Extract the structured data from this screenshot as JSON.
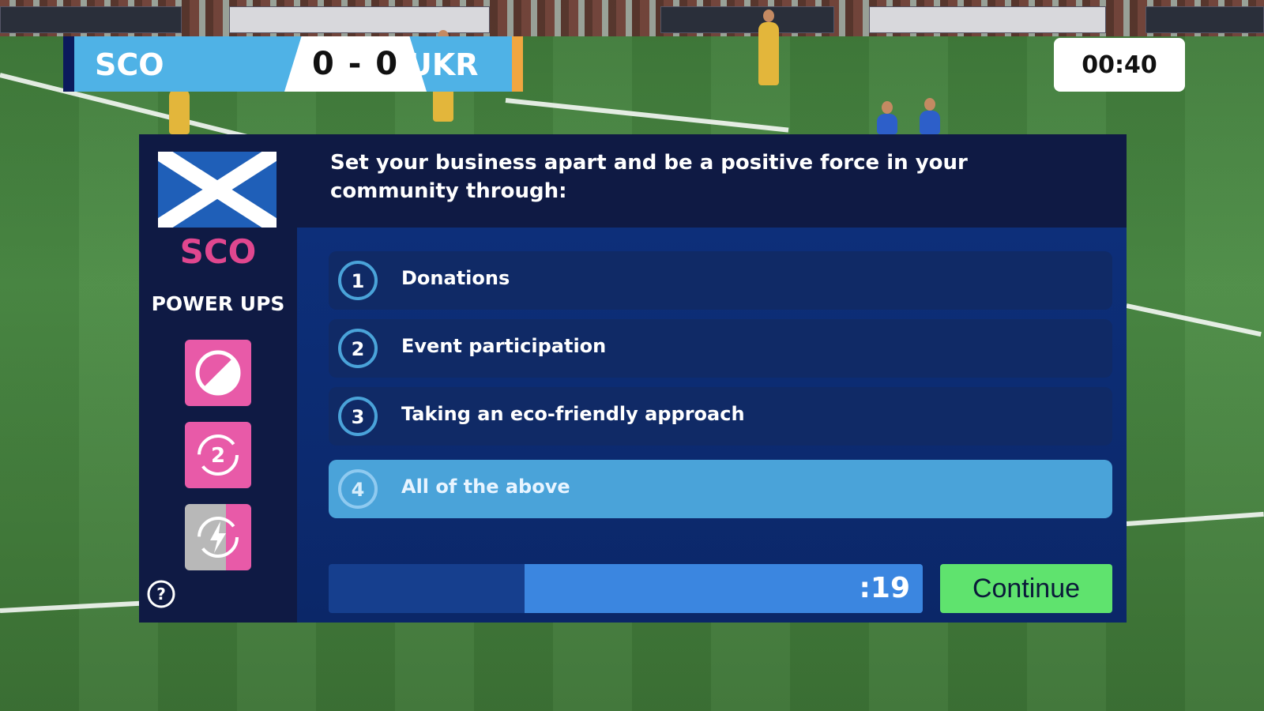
{
  "scoreboard": {
    "home_team": "SCO",
    "away_team": "UKR",
    "score": "0 - 0"
  },
  "match_clock": "00:40",
  "panel": {
    "team_code": "SCO",
    "powerups_title": "POWER UPS",
    "powerups": [
      {
        "icon": "fifty-fifty-icon",
        "enabled": true
      },
      {
        "icon": "second-chance-icon",
        "label": "2",
        "enabled": true
      },
      {
        "icon": "lightning-icon",
        "enabled": false
      }
    ],
    "question": "Set your business apart and be a positive force in your community through:",
    "answers": [
      {
        "number": "1",
        "label": "Donations"
      },
      {
        "number": "2",
        "label": "Event participation"
      },
      {
        "number": "3",
        "label": "Taking an eco-friendly approach"
      },
      {
        "number": "4",
        "label": "All of the above",
        "selected": true
      }
    ],
    "timer_text": ":19",
    "timer_remaining_fraction": 0.67,
    "continue_label": "Continue"
  },
  "colors": {
    "panel": "#0e1a4a",
    "team_code": "#e0478f",
    "selected_answer": "#4aa3d9",
    "continue": "#5fe36e",
    "powerup": "#e85aa8"
  }
}
